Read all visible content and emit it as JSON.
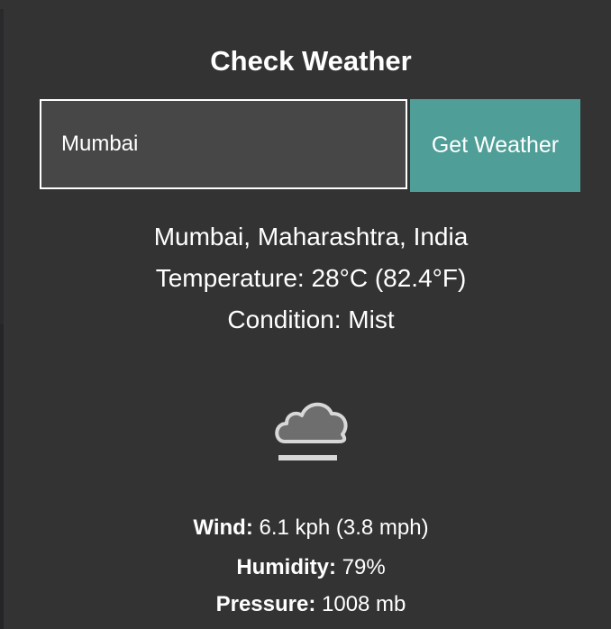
{
  "title": "Check Weather",
  "search": {
    "value": "Mumbai"
  },
  "button": {
    "label": "Get Weather"
  },
  "result": {
    "location": "Mumbai, Maharashtra, India",
    "temperature": "Temperature: 28°C (82.4°F)",
    "condition": "Condition: Mist",
    "icon": "mist-cloud-icon",
    "wind_label": "Wind:",
    "wind_value": " 6.1 kph (3.8 mph)",
    "humidity_label": "Humidity:",
    "humidity_value": " 79%",
    "pressure_label": "Pressure:",
    "pressure_value": " 1008 mb"
  },
  "colors": {
    "background": "#333333",
    "accent": "#4f9e97",
    "input_bg": "#474747"
  }
}
